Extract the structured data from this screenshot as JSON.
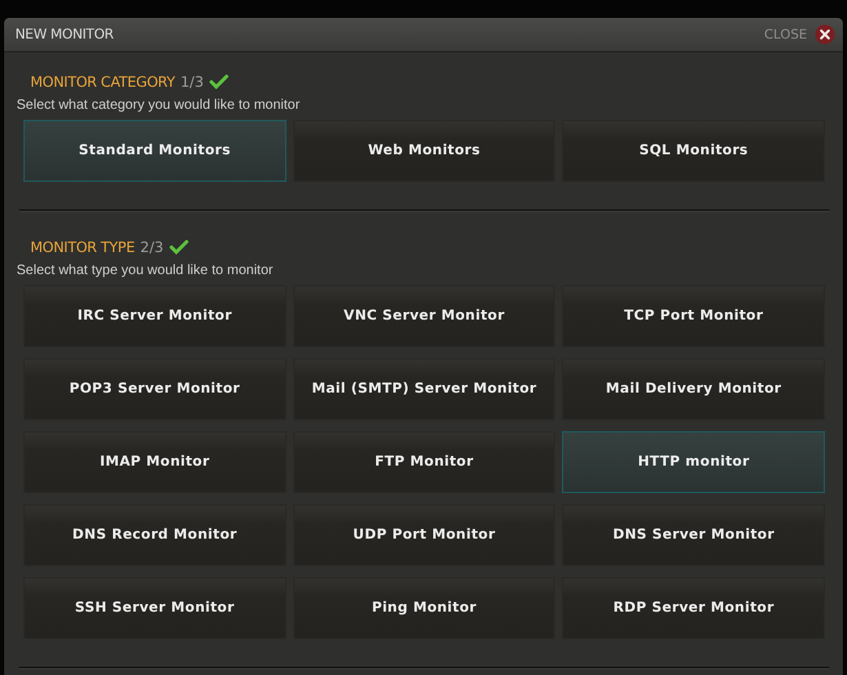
{
  "window": {
    "title": "NEW MONITOR",
    "close_label": "CLOSE"
  },
  "sections": [
    {
      "title": "MONITOR CATEGORY",
      "step": "1/3",
      "completed": true,
      "prompt": "Select what category you would like to monitor",
      "options": [
        {
          "label": "Standard Monitors",
          "selected": true
        },
        {
          "label": "Web Monitors",
          "selected": false
        },
        {
          "label": "SQL Monitors",
          "selected": false
        }
      ]
    },
    {
      "title": "MONITOR TYPE",
      "step": "2/3",
      "completed": true,
      "prompt": "Select what type you would like to monitor",
      "options": [
        {
          "label": "IRC Server Monitor",
          "selected": false
        },
        {
          "label": "VNC Server Monitor",
          "selected": false
        },
        {
          "label": "TCP Port Monitor",
          "selected": false
        },
        {
          "label": "POP3 Server Monitor",
          "selected": false
        },
        {
          "label": "Mail (SMTP) Server Monitor",
          "selected": false
        },
        {
          "label": "Mail Delivery Monitor",
          "selected": false
        },
        {
          "label": "IMAP Monitor",
          "selected": false
        },
        {
          "label": "FTP Monitor",
          "selected": false
        },
        {
          "label": "HTTP monitor",
          "selected": true
        },
        {
          "label": "DNS Record Monitor",
          "selected": false
        },
        {
          "label": "UDP Port Monitor",
          "selected": false
        },
        {
          "label": "DNS Server Monitor",
          "selected": false
        },
        {
          "label": "SSH Server Monitor",
          "selected": false
        },
        {
          "label": "Ping Monitor",
          "selected": false
        },
        {
          "label": "RDP Server Monitor",
          "selected": false
        }
      ]
    }
  ]
}
